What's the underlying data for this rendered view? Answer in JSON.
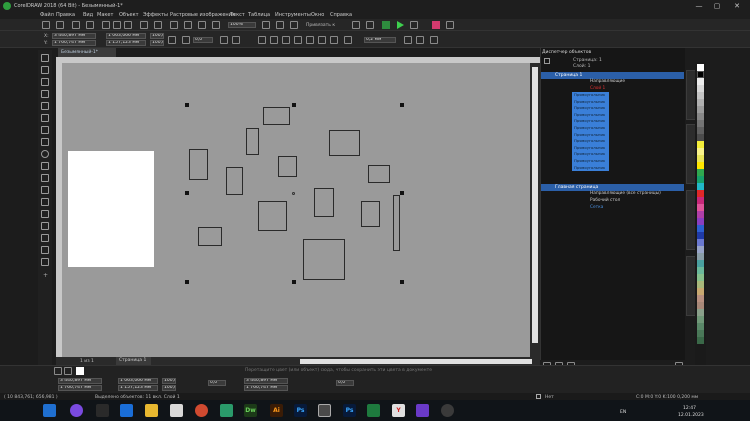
{
  "app": {
    "title": "CorelDRAW 2018 (64 Bit) - Безымянный-1*",
    "window_controls": [
      "—",
      "▢",
      "✕"
    ]
  },
  "menu": [
    "Файл",
    "Правка",
    "Вид",
    "Макет",
    "Объект",
    "Эффекты",
    "Растровые изображения",
    "Текст",
    "Таблица",
    "Инструменты",
    "Окно",
    "Справка"
  ],
  "toolbar": {
    "zoom": "100%",
    "snap_label": "Привязать к",
    "x": "3 440,897 мм",
    "y": "1 760,747 мм",
    "width": "1 063,066 мм",
    "height": "1 157,123 мм",
    "scale_x": "100,0",
    "scale_y": "100,0",
    "angle": "0,0",
    "outline_width": "0,2 мм"
  },
  "document": {
    "tab": "Безымянный-1*",
    "page_tab": "Страница 1",
    "page_counter": "1 из 1",
    "hint": "Перетащите цвет (или объект) сюда, чтобы сохранить эти цвета в документе"
  },
  "object_manager": {
    "title": "Диспетчер объектов",
    "page_label": "Страница: 1",
    "layer_label": "Слой: 1",
    "page1": "Страница 1",
    "layer_guides": "Направляющие",
    "layer1": "Слой 1",
    "items": [
      "Прямоугольник",
      "Прямоугольник",
      "Прямоугольник",
      "Прямоугольник",
      "Прямоугольник",
      "Прямоугольник",
      "Прямоугольник",
      "Прямоугольник",
      "Прямоугольник",
      "Прямоугольник",
      "Прямоугольник",
      "Прямоугольник"
    ],
    "master": "Главная страница",
    "master_layers": [
      "Направляющие (все страницы)",
      "Рабочий стол",
      "Сетка"
    ]
  },
  "side_tabs": [
    "Свойства объекта",
    "Диспетчер объектов",
    "Преобразования",
    "Выравнивание и распределение"
  ],
  "status": {
    "x": "3 440,897 мм",
    "y": "1 760,747 мм",
    "w": "1 063,066 мм",
    "h": "1 157,123 мм",
    "sx": "100,0",
    "sy": "100,0",
    "angle": "0,0",
    "x2": "3 440,897 мм",
    "y2": "1 760,747 мм",
    "zero": "0,0",
    "cursor": "( 10 843,761; 656,981 )",
    "selection": "Выделено объектов: 11 вкл. Слой 1",
    "fill": "Нет",
    "outline": "C:0 M:0 Y:0 K:100  0,200 мм"
  },
  "taskbar": {
    "lang": "EN",
    "time": "12:47",
    "date": "12.01.2023",
    "apps": [
      "Dw",
      "Ai",
      "Ps",
      "Ps"
    ]
  },
  "colors": {
    "canvas": "#9a9a9a",
    "selection_blue": "#3a7fd8",
    "header_blue": "#2b5fa8"
  }
}
